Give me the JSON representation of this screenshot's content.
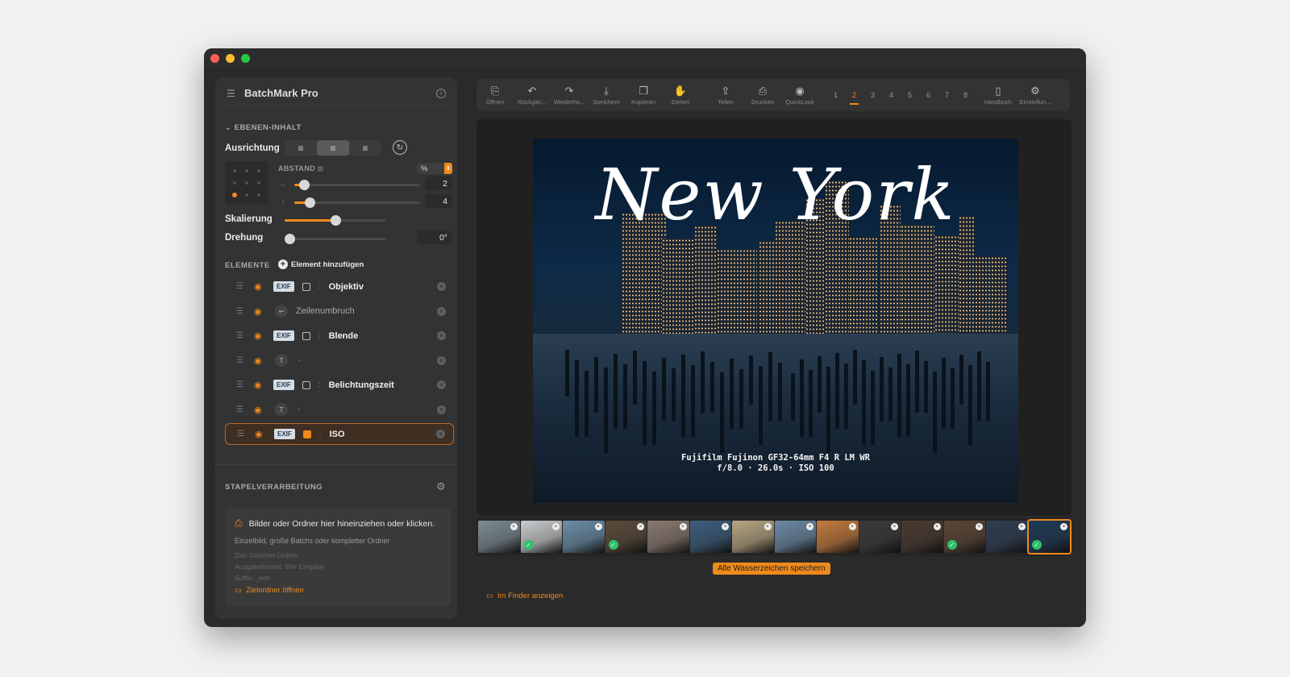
{
  "app": {
    "name": "BatchMark Pro"
  },
  "layer": {
    "section_title": "EBENEN-INHALT",
    "alignment_label": "Ausrichtung",
    "spacing_label": "ABSTAND",
    "spacing_unit": "%",
    "spacing_h": "2",
    "spacing_v": "4",
    "spacing_h_level": 0.08,
    "spacing_v_level": 0.12,
    "scale_label": "Skalierung",
    "scale_level": 0.5,
    "rotation_label": "Drehung",
    "rotation_value": "0°",
    "rotation_level": 0.0
  },
  "elements": {
    "section_title": "ELEMENTE",
    "add_label": "Element hinzufügen",
    "exif_tag": "EXIF",
    "text_tag": "T",
    "items": [
      {
        "type": "exif",
        "label": "Objektiv",
        "checked": false,
        "selected": false
      },
      {
        "type": "break",
        "label": "Zeilenumbruch",
        "checked": false,
        "selected": false
      },
      {
        "type": "exif",
        "label": "Blende",
        "checked": false,
        "selected": false
      },
      {
        "type": "text",
        "label": "·",
        "checked": false,
        "selected": false
      },
      {
        "type": "exif",
        "label": "Belichtungszeit",
        "checked": false,
        "selected": false
      },
      {
        "type": "text",
        "label": "·",
        "checked": false,
        "selected": false
      },
      {
        "type": "exif",
        "label": "ISO",
        "checked": true,
        "selected": true
      }
    ]
  },
  "batch": {
    "section_title": "STAPELVERARBEITUNG",
    "drop_text": "Bilder oder Ordner hier hineinziehen oder klicken.",
    "sub_text": "Einzelbild, große Batchs oder kompletter Ordner",
    "target": "Ziel: Gleicher Ordner",
    "format": "Ausgabeformat: Wie Eingabe",
    "suffix": "Suffix: _wm",
    "open_folder": "Zielordner öffnen"
  },
  "toolbar": {
    "buttons": [
      {
        "icon": "open-icon",
        "label": "Öffnen"
      },
      {
        "icon": "undo-icon",
        "label": "Rückgän..."
      },
      {
        "icon": "redo-icon",
        "label": "Wiederho..."
      },
      {
        "icon": "save-icon",
        "label": "Speichern"
      },
      {
        "icon": "copy-icon",
        "label": "Kopieren"
      },
      {
        "icon": "drag-hand-icon",
        "label": "Ziehen"
      },
      {
        "icon": "share-icon",
        "label": "Teilen"
      },
      {
        "icon": "print-icon",
        "label": "Drucken"
      },
      {
        "icon": "eye-icon",
        "label": "QuickLook"
      }
    ],
    "presets": [
      "1",
      "2",
      "3",
      "4",
      "5",
      "6",
      "7",
      "8"
    ],
    "active_preset": "2",
    "right_buttons": [
      {
        "icon": "book-icon",
        "label": "Handbuch"
      },
      {
        "icon": "gear-icon",
        "label": "Einstellun..."
      }
    ]
  },
  "preview": {
    "watermark_title": "New York",
    "line1": "Fujifilm Fujinon GF32-64mm F4 R LM WR",
    "line2": "f/8.0 · 26.0s · ISO 100"
  },
  "filmstrip": {
    "thumbs": [
      {
        "color": "#7d8c95",
        "done": false
      },
      {
        "color": "#c9ccce",
        "done": true
      },
      {
        "color": "#6b8ea8",
        "done": false
      },
      {
        "color": "#5a4a3a",
        "done": true
      },
      {
        "color": "#8a7a70",
        "done": false
      },
      {
        "color": "#3c5e7e",
        "done": false
      },
      {
        "color": "#b8a684",
        "done": false
      },
      {
        "color": "#6d8aa6",
        "done": false
      },
      {
        "color": "#c27a3c",
        "done": false
      },
      {
        "color": "#3a3a3c",
        "done": false
      },
      {
        "color": "#4a3a30",
        "done": false
      },
      {
        "color": "#5c4636",
        "done": true
      },
      {
        "color": "#2f3e52",
        "done": false
      },
      {
        "color": "#1d3a56",
        "done": true,
        "selected": true
      }
    ],
    "save_all": "Alle Wasserzeichen speichern"
  },
  "footer": {
    "finder": "Im Finder anzeigen"
  },
  "colors": {
    "accent": "#f08a1c",
    "bg": "#2a2a2a",
    "panel": "#333333"
  }
}
